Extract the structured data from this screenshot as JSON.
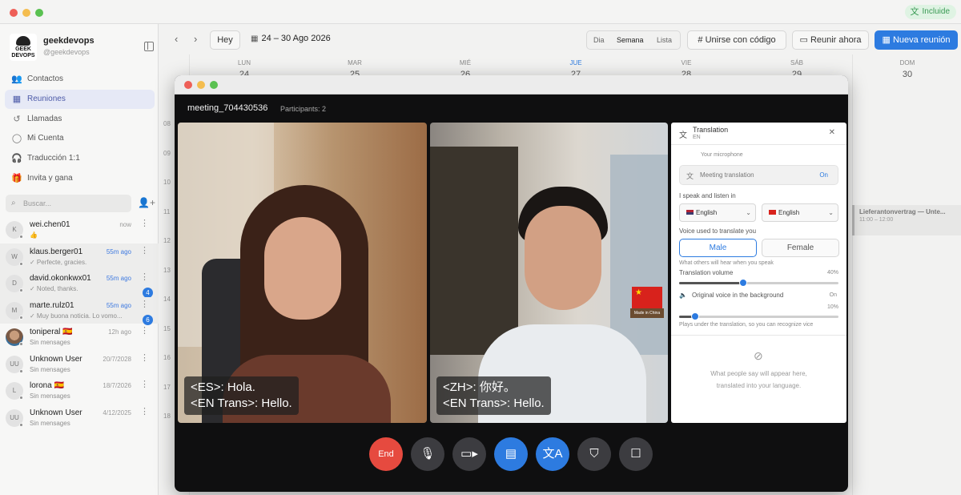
{
  "topbar": {
    "badge_label": "Incluide",
    "badge_icon": "translate-icon"
  },
  "sidebar": {
    "profile": {
      "name": "geekdevops",
      "handle": "@geekdevops",
      "logo_text": "GEEK DEVOPS"
    },
    "nav": [
      {
        "label": "Contactos",
        "icon": "contacts-icon"
      },
      {
        "label": "Reuniones",
        "icon": "calendar-icon"
      },
      {
        "label": "Llamadas",
        "icon": "call-history-icon"
      },
      {
        "label": "Mi Cuenta",
        "icon": "user-icon"
      },
      {
        "label": "Traducción 1:1",
        "icon": "headset-icon"
      },
      {
        "label": "Invita y gana",
        "icon": "gift-icon"
      }
    ],
    "search_placeholder": "Buscar...",
    "chats": [
      {
        "initials": "K",
        "name": "wei.chen01",
        "message": "👍",
        "time": "now",
        "time_color": "#9a9a9a",
        "unread": ""
      },
      {
        "initials": "W",
        "name": "klaus.berger01",
        "message": "✓ Perfecte, gracies.",
        "time": "55m ago",
        "time_color": "#3f7ae0",
        "unread": ""
      },
      {
        "initials": "D",
        "name": "david.okonkwx01",
        "message": "✓ Noted, thanks.",
        "time": "55m ago",
        "time_color": "#3f7ae0",
        "unread": "4"
      },
      {
        "initials": "M",
        "name": "marte.rulz01",
        "message": "✓ Muy buona noticia. Lo vomo...",
        "time": "55m ago",
        "time_color": "#3f7ae0",
        "unread": "6"
      },
      {
        "initials": "",
        "name": "toniperal 🇪🇸",
        "message": "Sin mensages",
        "time": "12h ago",
        "time_color": "#9a9a9a",
        "unread": ""
      },
      {
        "initials": "UU",
        "name": "Unknown User",
        "message": "Sin mensages",
        "time": "20/7/2028",
        "time_color": "#9a9a9a",
        "unread": ""
      },
      {
        "initials": "L",
        "name": "lorona 🇪🇸",
        "message": "Sin mensages",
        "time": "18/7/2026",
        "time_color": "#9a9a9a",
        "unread": ""
      },
      {
        "initials": "UU",
        "name": "Unknown User",
        "message": "Sin mensages",
        "time": "4/12/2025",
        "time_color": "#9a9a9a",
        "unread": ""
      }
    ]
  },
  "calendar": {
    "today_label": "Hey",
    "date_range": "24 – 30 Ago 2026",
    "views": [
      "Dia",
      "Semana",
      "Lista"
    ],
    "join_label": "Unirse con código",
    "meet_now_label": "Reunir ahora",
    "new_meeting_label": "Nueva reunión",
    "days": [
      {
        "label": "LUN",
        "num": "24"
      },
      {
        "label": "MAR",
        "num": "25"
      },
      {
        "label": "MIÉ",
        "num": "26"
      },
      {
        "label": "JUE",
        "num": "27"
      },
      {
        "label": "VIE",
        "num": "28"
      },
      {
        "label": "SÁB",
        "num": "29"
      },
      {
        "label": "DOM",
        "num": "30"
      }
    ],
    "hours": [
      "08",
      "09",
      "10",
      "11",
      "12",
      "13",
      "14",
      "15",
      "16",
      "17",
      "18"
    ],
    "event": {
      "title": "Lieferantonvertrag — Unte...",
      "time": "11:00 – 12:00"
    }
  },
  "meeting": {
    "title": "meeting_704430536",
    "participants": "Participants: 2",
    "tiles": [
      {
        "caption_line1": "<ES>: Hola.",
        "caption_line2": "<EN Trans>: Hello."
      },
      {
        "caption_line1": "<ZH>: 你好。",
        "caption_line2": "<EN Trans>: Hello."
      }
    ],
    "flag_label": "Made in China",
    "panel": {
      "title": "Translation",
      "subtitle": "EN",
      "mic_label": "Your microphone",
      "toggle_label": "Meeting translation",
      "toggle_state": "On",
      "speak_label": "I speak and listen in",
      "lang_left": "English",
      "lang_right": "English",
      "voice_label": "Voice used to translate you",
      "voice_male": "Male",
      "voice_female": "Female",
      "hear_note": "What others will hear when you speak",
      "volume_label": "Translation volume",
      "volume_value": "40%",
      "volume_level": 0.4,
      "original_label": "Original voice in the background",
      "original_state": "On",
      "original_value": "10%",
      "original_level": 0.1,
      "plays_note": "Plays under the translation, so you can recognize vice",
      "empty_line1": "What people say will appear here,",
      "empty_line2": "translated into your language."
    },
    "controls": [
      {
        "name": "end-call-button",
        "label": "End"
      },
      {
        "name": "microphone-button",
        "icon": "mic-icon"
      },
      {
        "name": "camera-button",
        "icon": "video-icon"
      },
      {
        "name": "captions-button",
        "icon": "captions-icon"
      },
      {
        "name": "translation-button",
        "icon": "translate-icon"
      },
      {
        "name": "security-button",
        "icon": "shield-icon"
      },
      {
        "name": "chat-button",
        "icon": "chat-icon"
      }
    ]
  },
  "colors": {
    "accent": "#2d7be0",
    "end_call": "#e64a3f",
    "active_nav": "#e6e9f6"
  }
}
